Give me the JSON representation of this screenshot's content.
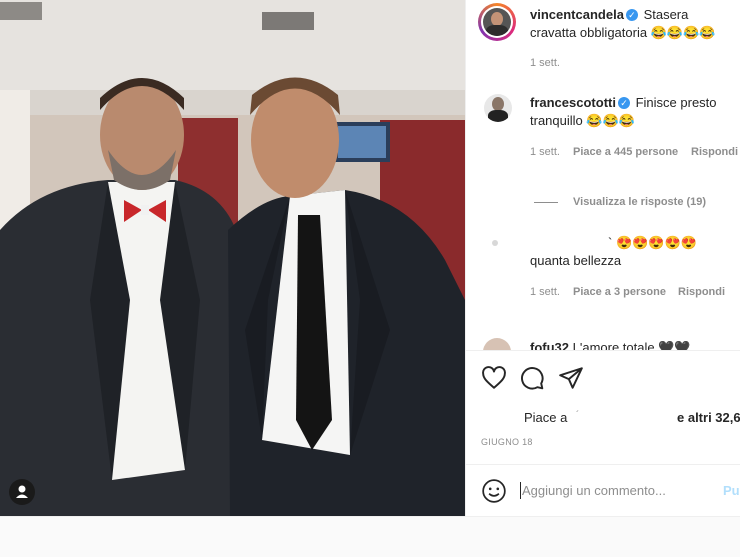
{
  "post": {
    "photo_alt": "",
    "user_tag_icon": "user-tag-icon"
  },
  "caption": {
    "username": "vincentcandela",
    "text": "Stasera cravatta obbligatoria",
    "emojis": "😂😂😂😂",
    "time": "1 sett."
  },
  "comments": [
    {
      "username": "francescototti",
      "text": "Finisce presto tranquillo",
      "emojis": "😂😂😂",
      "time": "1 sett.",
      "likes": "Piace a 445 persone",
      "reply": "Rispondi",
      "view_replies": "Visualizza le risposte (19)"
    },
    {
      "username": "",
      "text": "quanta bellezza",
      "emojis_prefix": "`",
      "emojis": "😍😍😍😍😍",
      "time": "1 sett.",
      "likes": "Piace a 3 persone",
      "reply": "Rispondi"
    },
    {
      "username": "fofu32",
      "text": "L'amore totale",
      "emojis": "🖤🖤"
    }
  ],
  "actions": {
    "like_icon": "heart-icon",
    "comment_icon": "comment-icon",
    "share_icon": "send-icon",
    "likes_prefix": "Piace a",
    "likes_suffix": "e altri 32,6",
    "date": "GIUGNO 18"
  },
  "comment_box": {
    "emoji_icon": "smiley-icon",
    "placeholder": "Aggiungi un commento...",
    "post_label": "Pu"
  }
}
